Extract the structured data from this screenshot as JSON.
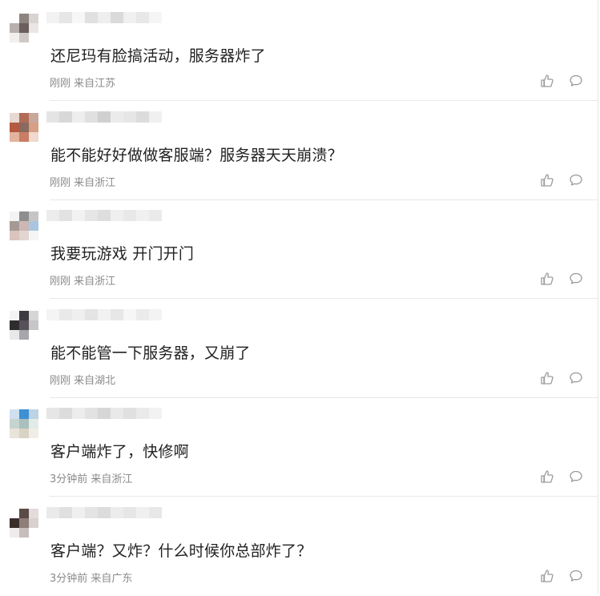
{
  "comments": [
    {
      "text": "还尼玛有脸搞活动，服务器炸了",
      "time": "刚刚",
      "location": "来自江苏",
      "avatar_colors": [
        "#ffffff",
        "#8d8481",
        "#d9d3d1",
        "#b8b0ad",
        "#6a5f5c",
        "#e9e6e5",
        "#f2f0ef",
        "#cfc8c6",
        "#ffffff"
      ],
      "name_blur_colors": [
        "#f2f2f2",
        "#e6e6e6",
        "#f7f7f7",
        "#e0e0e0",
        "#eeeeee",
        "#dadada",
        "#f0f0f0",
        "#e8e8e8",
        "#f5f5f5"
      ]
    },
    {
      "text": "能不能好好做做客服端？服务器天天崩溃？",
      "time": "刚刚",
      "location": "来自浙江",
      "avatar_colors": [
        "#e8d8d2",
        "#b26b56",
        "#c9a89c",
        "#b45a3f",
        "#8a6a5e",
        "#d79f86",
        "#e3b39e",
        "#c87d64",
        "#f0d9ce"
      ],
      "name_blur_colors": [
        "#e4e4e4",
        "#d8d8d8",
        "#eeeeee",
        "#e0e0e0",
        "#d0d0d0",
        "#ebebeb",
        "#e6e6e6",
        "#dcdcdc",
        "#f0f0f0"
      ]
    },
    {
      "text": "我要玩游戏 开门开门",
      "time": "刚刚",
      "location": "来自浙江",
      "avatar_colors": [
        "#f3f3f3",
        "#8e8e8e",
        "#c5c5c5",
        "#a69995",
        "#cbb8b4",
        "#a9c5e0",
        "#d9c4be",
        "#e2d5d2",
        "#f5f5f5"
      ],
      "name_blur_colors": [
        "#ececec",
        "#e2e2e2",
        "#f2f2f2",
        "#e6e6e6",
        "#dedede",
        "#efefef",
        "#e8e8e8",
        "#f0f0f0",
        "#eaeaea"
      ]
    },
    {
      "text": "能不能管一下服务器，又崩了",
      "time": "刚刚",
      "location": "来自湖北",
      "avatar_colors": [
        "#f4f4f4",
        "#3b3b40",
        "#d6d6d8",
        "#2f2c30",
        "#56505a",
        "#c6c5c8",
        "#e9e8ea",
        "#a7a6aa",
        "#ffffff"
      ],
      "name_blur_colors": [
        "#f4f4f4",
        "#e9e9e9",
        "#efefef",
        "#e4e4e4",
        "#f1f1f1",
        "#e7e7e7",
        "#f6f6f6",
        "#ebebeb",
        "#f3f3f3"
      ]
    },
    {
      "text": "客户端炸了，快修啊",
      "time": "3分钟前",
      "location": "来自浙江",
      "avatar_colors": [
        "#cfe0ef",
        "#3f8fd4",
        "#bcd3e6",
        "#c6d4cf",
        "#a9c0bd",
        "#e3ebe8",
        "#e9e3d8",
        "#d8d3c5",
        "#f0ede6"
      ],
      "name_blur_colors": [
        "#e6e6e6",
        "#dcdcdc",
        "#ededed",
        "#e2e2e2",
        "#d6d6d6",
        "#e9e9e9",
        "#e0e0e0",
        "#eaeaea",
        "#f2f2f2"
      ]
    },
    {
      "text": "客户端？又炸？什么时候你总部炸了？",
      "time": "3分钟前",
      "location": "来自广东",
      "avatar_colors": [
        "#ffffff",
        "#5a4b47",
        "#e3dcdb",
        "#3a2d2a",
        "#8e7e79",
        "#d9d1cf",
        "#efebea",
        "#c7bebc",
        "#ffffff"
      ],
      "name_blur_colors": [
        "#eaeaea",
        "#e0e0e0",
        "#efefef",
        "#e4e4e4",
        "#dcdcdc",
        "#ececec",
        "#e6e6e6",
        "#f0f0f0",
        "#e8e8e8"
      ]
    }
  ],
  "icons": {
    "like": "thumbs-up-icon",
    "reply": "speech-bubble-icon"
  },
  "colors": {
    "text": "#222222",
    "meta": "#8a8a8a",
    "icon": "#9a9a9a",
    "divider": "#e9e9e9"
  }
}
